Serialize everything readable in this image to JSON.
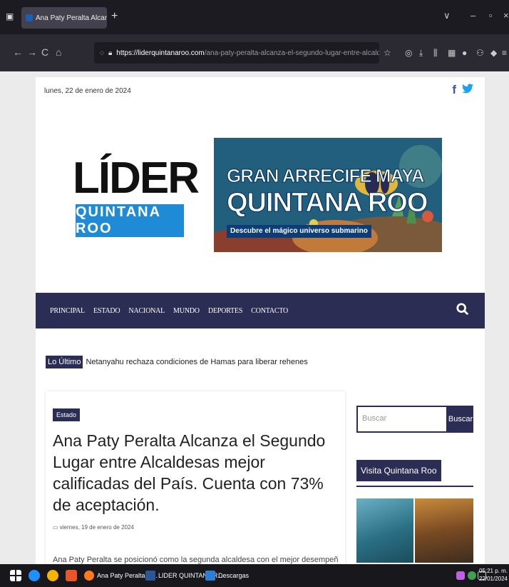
{
  "browser": {
    "tab_title": "Ana Paty Peralta Alcanza el Seg",
    "tab_close": "×",
    "new_tab": "+",
    "url_host": "https://liderquintanaroo.com",
    "url_path": "/ana-paty-peralta-alcanza-el-segundo-lugar-entre-alcaldesas-mej",
    "nav_back": "←",
    "nav_forward": "→",
    "nav_reload": "C",
    "nav_home": "⌂",
    "win_dropdown": "∨",
    "win_minimize": "–",
    "win_restore": "▫",
    "win_close": "×"
  },
  "header": {
    "date": "lunes, 22 de enero de 2024",
    "facebook": "f",
    "twitter": "✔"
  },
  "logo": {
    "main": "LÍDER",
    "sub": "QUINTANA ROO"
  },
  "banner": {
    "line1": "GRAN ARRECIFE MAYA",
    "line2": "QUINTANA ROO",
    "tagline": "Descubre el mágico universo submarino"
  },
  "menu": {
    "items": [
      "PRINCIPAL",
      "ESTADO",
      "NACIONAL",
      "MUNDO",
      "DEPORTES",
      "CONTACTO"
    ]
  },
  "ticker": {
    "label": "Lo Último",
    "text": "Netanyahu rechaza condiciones de Hamas para liberar rehenes"
  },
  "article": {
    "category": "Estado",
    "headline": "Ana Paty Peralta Alcanza el Segundo Lugar entre Alcaldesas mejor calificadas del País. Cuenta con 73% de aceptación.",
    "date": "viernes, 19 de enero de 2024",
    "excerpt": "Ana Paty Peralta se posicionó como la segunda alcaldesa con el mejor desempeño según C&F Research. El"
  },
  "sidebar": {
    "search_placeholder": "Buscar",
    "search_button": "Buscar",
    "widget_title": "Visita Quintana Roo"
  },
  "taskbar": {
    "app1": "Ana Paty Peralta Al...",
    "app2": "LIDER QUINTANA R...",
    "app3": "Descargas",
    "time": "05:21 p. m.",
    "date": "22/01/2024"
  },
  "colors": {
    "navy": "#2b2d54",
    "logo_blue": "#1f8bd6"
  }
}
